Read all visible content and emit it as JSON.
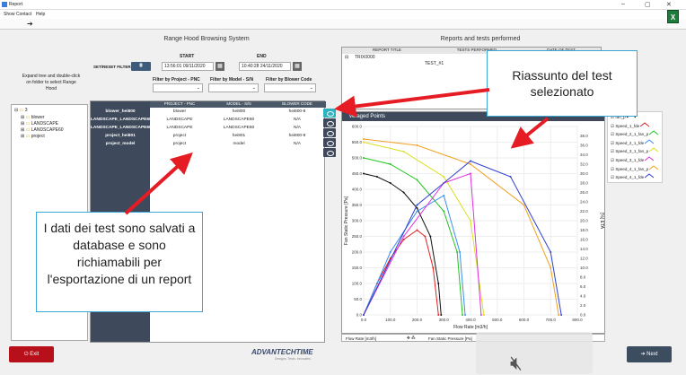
{
  "window": {
    "title": "Report",
    "minimize": "–",
    "maximize": "▢",
    "close": "✕"
  },
  "menu": {
    "items": [
      "Show",
      "Contact",
      "Help"
    ]
  },
  "left": {
    "title": "Range Hood Browsing System",
    "set_reset_filters": "SET/RESET FILTERS",
    "start_label": "START",
    "start_value": "13:56:01 09/11/2020",
    "end_label": "END",
    "end_value": "10:40:28 24/11/2020",
    "filter_project": "Filter by Project - PNC",
    "filter_model": "Filter by Model - S/N",
    "filter_blower": "Filter by Blower Code",
    "instructions": "Expand tree and double-click on folder to select Range Hood",
    "tree": [
      "3",
      "blower",
      "LANDSCAPE",
      "LANDSCAPE60",
      "project"
    ],
    "columns": [
      "PROJECT - PNC",
      "MODEL - S/N",
      "BLOWER CODE"
    ],
    "rows": [
      {
        "name": "blower_hei800",
        "project": "blower",
        "model": "hei800",
        "blower": "hei800-8"
      },
      {
        "name": "LANDSCAPE_LANDSCAPE60",
        "project": "LANDSCAPE",
        "model": "LANDSCAPE60",
        "blower": "N/A"
      },
      {
        "name": "LANDSCAPE_LANDSCAPE60",
        "project": "LANDSCAPE",
        "model": "LANDSCAPE60",
        "blower": "N/A"
      },
      {
        "name": "project_hei801",
        "project": "project",
        "model": "hei801",
        "blower": "hei800-8"
      },
      {
        "name": "project_model",
        "project": "project",
        "model": "model",
        "blower": "N/A"
      }
    ]
  },
  "right": {
    "title": "Reports and tests performed",
    "columns": [
      "REPORT TITLE",
      "TESTS PERFORMED",
      "DATE OF TEST"
    ],
    "report_title": "TRIX0000",
    "test": "TEST_#1",
    "chart_header": "veraged Points",
    "status_fields": [
      "Flow Rate [m3/h]",
      "Fan Static Pressure [Pa]"
    ]
  },
  "callouts": {
    "summary": "Riassunto del test selezionato",
    "database": "I dati dei test sono salvati a database e sono richiamabili per l'esportazione di un report"
  },
  "footer": {
    "exit": "Exit",
    "next": "Next",
    "logo": "ADVANTECHTIME",
    "tagline": "Designs. Tests. Innovates."
  },
  "chart_data": {
    "type": "line",
    "xlabel": "Flow Rate [m3/h]",
    "ylabel": "Fan Static Pressure [Pa]",
    "y2label": "[%] ETA",
    "xlim": [
      0,
      800
    ],
    "ylim": [
      0,
      600
    ],
    "y2lim": [
      0,
      40
    ],
    "x_ticks": [
      "0.0",
      "100.0",
      "200.0",
      "300.0",
      "400.0",
      "500.0",
      "600.0",
      "700.0",
      "800.0"
    ],
    "y_ticks": [
      "0.0",
      "50.0",
      "100.0",
      "150.0",
      "200.0",
      "250.0",
      "300.0",
      "350.0",
      "400.0",
      "450.0",
      "500.0",
      "550.0",
      "600.0"
    ],
    "y2_ticks": [
      "0.0",
      "2.0",
      "4.0",
      "6.0",
      "8.0",
      "10.0",
      "12.0",
      "14.0",
      "16.0",
      "18.0",
      "20.0",
      "22.0",
      "24.0",
      "26.0",
      "28.0",
      "30.0",
      "32.0",
      "34.0",
      "36.0",
      "38.0"
    ],
    "legend_position": "right",
    "series": [
      {
        "name": "fan_p",
        "color": "#111111",
        "points": [
          [
            0,
            450
          ],
          [
            50,
            440
          ],
          [
            100,
            420
          ],
          [
            150,
            390
          ],
          [
            200,
            340
          ],
          [
            250,
            250
          ],
          [
            280,
            100
          ],
          [
            290,
            0
          ]
        ]
      },
      {
        "name": "Speed_1_fde",
        "color": "#e02020",
        "points": [
          [
            0,
            0
          ],
          [
            50,
            100
          ],
          [
            100,
            180
          ],
          [
            150,
            240
          ],
          [
            200,
            270
          ],
          [
            230,
            250
          ],
          [
            260,
            150
          ],
          [
            280,
            0
          ]
        ]
      },
      {
        "name": "Speed_2_1_fan_p",
        "color": "#22c422",
        "points": [
          [
            0,
            500
          ],
          [
            100,
            480
          ],
          [
            200,
            430
          ],
          [
            300,
            330
          ],
          [
            350,
            200
          ],
          [
            370,
            0
          ]
        ]
      },
      {
        "name": "Speed_2_1_fde",
        "color": "#3a8ef0",
        "points": [
          [
            0,
            0
          ],
          [
            100,
            200
          ],
          [
            200,
            330
          ],
          [
            300,
            380
          ],
          [
            360,
            200
          ],
          [
            380,
            0
          ]
        ]
      },
      {
        "name": "Speed_3_1_fan_p",
        "color": "#d8e020",
        "points": [
          [
            0,
            550
          ],
          [
            150,
            520
          ],
          [
            300,
            440
          ],
          [
            400,
            300
          ],
          [
            450,
            0
          ]
        ]
      },
      {
        "name": "Speed_3_1_fde",
        "color": "#e030e0",
        "points": [
          [
            0,
            0
          ],
          [
            150,
            250
          ],
          [
            300,
            420
          ],
          [
            400,
            450
          ],
          [
            440,
            0
          ]
        ]
      },
      {
        "name": "Speed_4_1_fan_p",
        "color": "#f0a020",
        "points": [
          [
            0,
            560
          ],
          [
            200,
            540
          ],
          [
            400,
            480
          ],
          [
            600,
            350
          ],
          [
            700,
            150
          ],
          [
            730,
            0
          ]
        ]
      },
      {
        "name": "Speed_4_1_fde",
        "color": "#3040d0",
        "points": [
          [
            0,
            0
          ],
          [
            200,
            350
          ],
          [
            400,
            490
          ],
          [
            550,
            440
          ],
          [
            700,
            200
          ],
          [
            740,
            0
          ]
        ]
      }
    ]
  }
}
